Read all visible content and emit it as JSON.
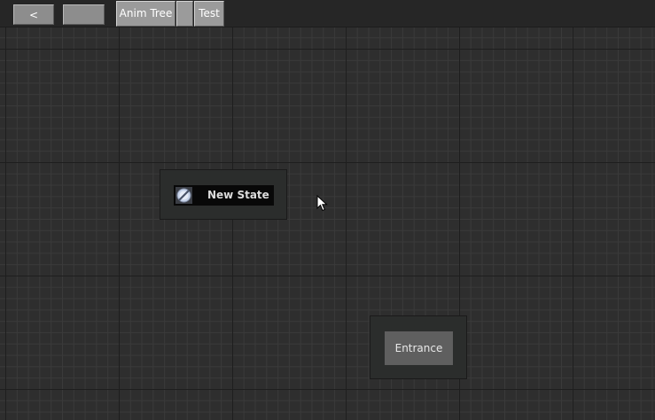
{
  "toolbar": {
    "back_label": "<",
    "blank_label": "",
    "anim_tree_label": "Anim Tree",
    "small_label": "",
    "test_label": "Test"
  },
  "nodes": {
    "new_state": {
      "label": "New State",
      "icon": "state-no-motion-icon"
    },
    "entrance": {
      "label": "Entrance"
    }
  },
  "cursor": {
    "icon": "mouse-pointer-icon"
  },
  "colors": {
    "canvas_bg": "#2e2e2e",
    "major_grid": "#1e1e1e",
    "minor_grid": "#3a3a3a",
    "button_face": "#9b9b9b",
    "node_bg": "#2b2d2c",
    "state_label_bg": "#080808",
    "entrance_bg": "#5f5f5f"
  }
}
